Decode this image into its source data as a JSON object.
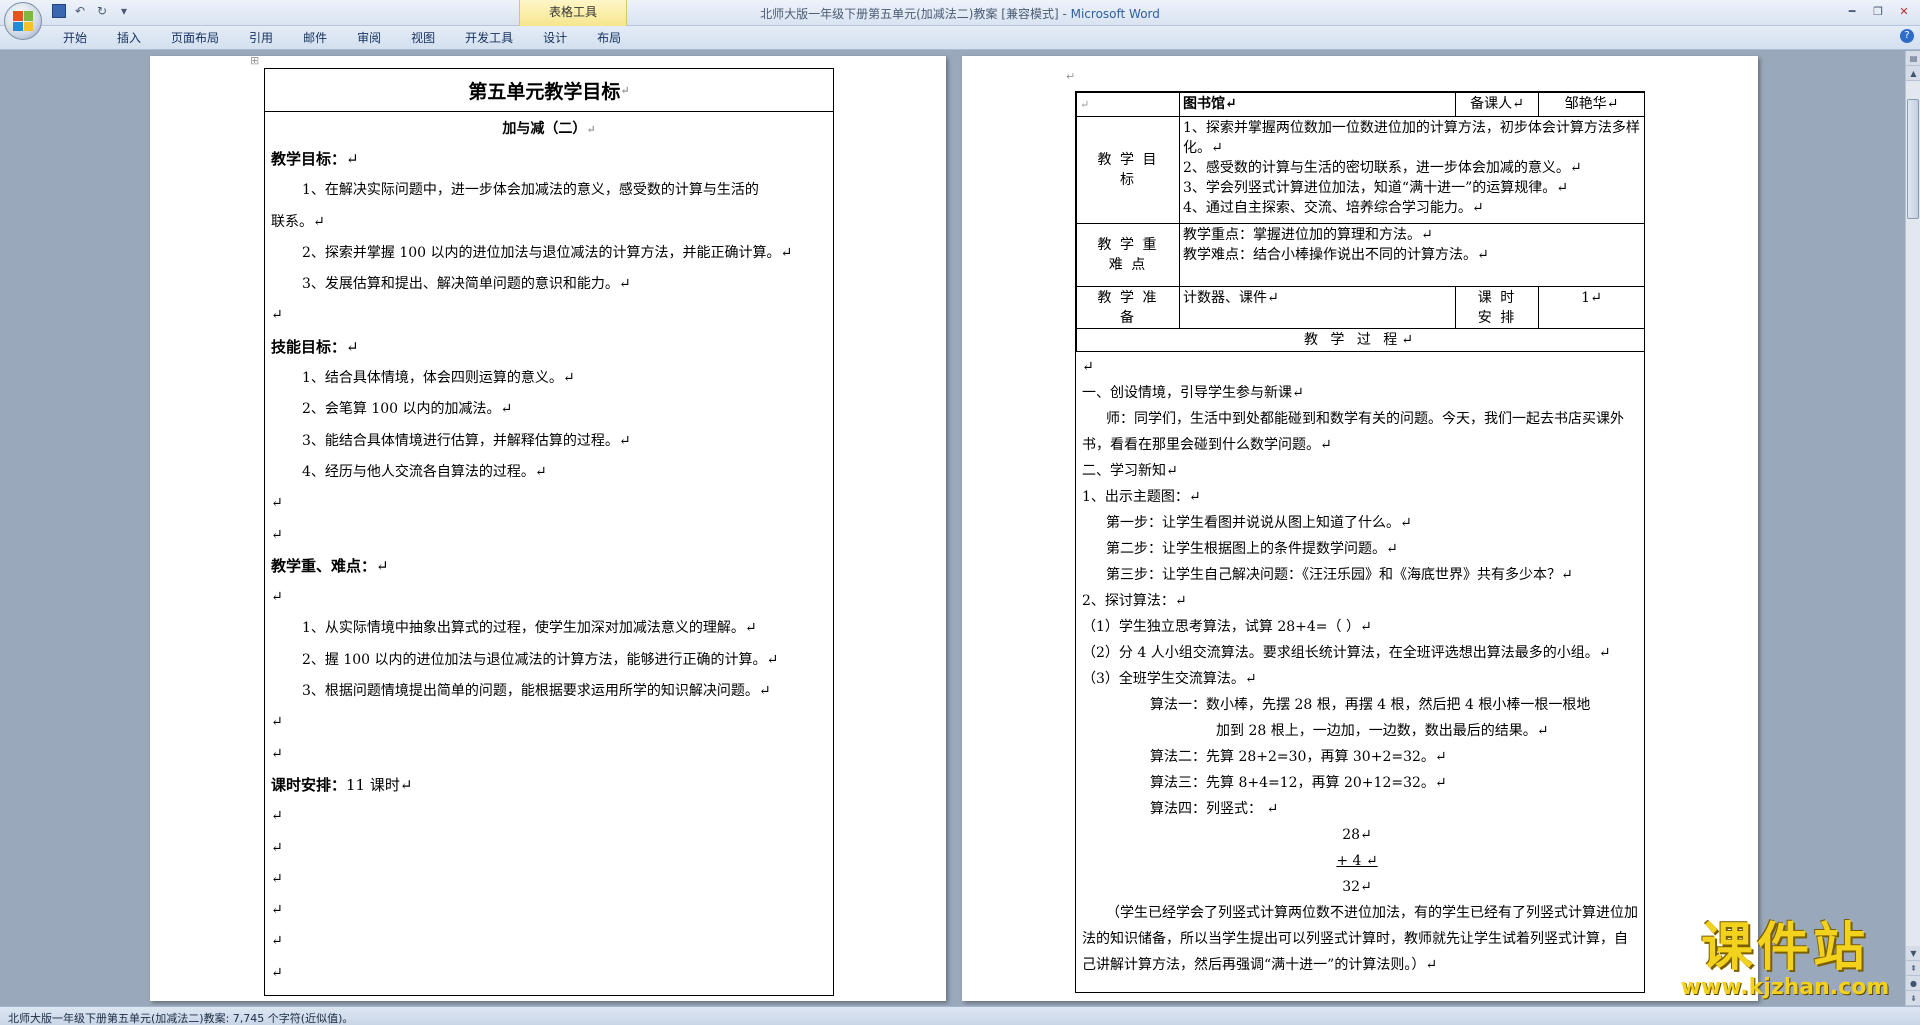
{
  "window": {
    "title": "北师大版一年级下册第五单元(加减法二)教案 [兼容模式] - ",
    "app_name": "Microsoft Word",
    "context_tab_group": "表格工具"
  },
  "ribbon": {
    "tabs": [
      "开始",
      "插入",
      "页面布局",
      "引用",
      "邮件",
      "审阅",
      "视图",
      "开发工具",
      "设计",
      "布局"
    ]
  },
  "left_page": {
    "title": "第五单元教学目标",
    "subtitle": "加与减（二）",
    "lines": [
      {
        "type": "head",
        "text": "教学目标：",
        "mark": "↵"
      },
      {
        "type": "ind",
        "text": "1、在解决实际问题中，进一步体会加减法的意义，感受数的计算与生活的"
      },
      {
        "type": "plain",
        "text": "联系。↵"
      },
      {
        "type": "ind",
        "text": "2、探索并掌握 100 以内的进位加法与退位减法的计算方法，并能正确计算。↵"
      },
      {
        "type": "ind",
        "text": "3、发展估算和提出、解决简单问题的意识和能力。↵"
      },
      {
        "type": "plain",
        "text": "↵"
      },
      {
        "type": "head",
        "text": "技能目标：",
        "mark": "↵"
      },
      {
        "type": "ind",
        "text": "1、结合具体情境，体会四则运算的意义。↵"
      },
      {
        "type": "ind",
        "text": "2、会笔算 100 以内的加减法。↵"
      },
      {
        "type": "ind",
        "text": "3、能结合具体情境进行估算，并解释估算的过程。↵"
      },
      {
        "type": "ind",
        "text": "4、经历与他人交流各自算法的过程。↵"
      },
      {
        "type": "plain",
        "text": "↵"
      },
      {
        "type": "plain",
        "text": "↵"
      },
      {
        "type": "head",
        "text": "教学重、难点：",
        "mark": "↵"
      },
      {
        "type": "plain",
        "text": "↵"
      },
      {
        "type": "ind",
        "text": "1、从实际情境中抽象出算式的过程，使学生加深对加减法意义的理解。↵"
      },
      {
        "type": "ind",
        "text": "2、握 100 以内的进位加法与退位减法的计算方法，能够进行正确的计算。↵"
      },
      {
        "type": "ind",
        "text": "3、根据问题情境提出简单的问题，能根据要求运用所学的知识解决问题。↵"
      },
      {
        "type": "plain",
        "text": "↵"
      },
      {
        "type": "plain",
        "text": "↵"
      },
      {
        "type": "head",
        "text": "课时安排：",
        "mark": "11 课时↵"
      },
      {
        "type": "plain",
        "text": "↵"
      },
      {
        "type": "plain",
        "text": "↵"
      },
      {
        "type": "plain",
        "text": "↵"
      },
      {
        "type": "plain",
        "text": "↵"
      },
      {
        "type": "plain",
        "text": "↵"
      },
      {
        "type": "plain",
        "text": "↵"
      }
    ]
  },
  "right_page": {
    "table": {
      "topic": "图书馆↵",
      "preparer_label": "备课人↵",
      "preparer_name": "邹艳华↵",
      "goals_label": "教 学 目 标",
      "goals": [
        "1、探索并掌握两位数加一位数进位加的计算方法，初步体会计算方法多样化。↵",
        "2、感受数的计算与生活的密切联系，进一步体会加减的意义。↵",
        "3、学会列竖式计算进位加法，知道“满十进一”的运算规律。↵",
        "4、通过自主探索、交流、培养综合学习能力。↵"
      ],
      "keypoints_label": "教 学 重 难 点",
      "keypoints": [
        " 教学重点：掌握进位加的算理和方法。↵",
        "教学难点：结合小棒操作说出不同的计算方法。↵"
      ],
      "prep_label": "教 学 准 备",
      "prep_value": "计数器、课件↵",
      "hours_label": "课 时 安 排",
      "hours_value": "1↵",
      "process_label": "教 学 过 程↵"
    },
    "lines": [
      {
        "cls": "",
        "text": "↵"
      },
      {
        "cls": "",
        "text": "一、创设情境，引导学生参与新课↵"
      },
      {
        "cls": "wrap i1",
        "text": "师：同学们，生活中到处都能碰到和数学有关的问题。今天，我们一起去书店买课外书，看看在那里会碰到什么数学问题。↵"
      },
      {
        "cls": "",
        "text": "二、学习新知↵"
      },
      {
        "cls": "",
        "text": "1、出示主题图：↵"
      },
      {
        "cls": "i1",
        "text": "第一步：让学生看图并说说从图上知道了什么。↵"
      },
      {
        "cls": "i1",
        "text": "第二步：让学生根据图上的条件提数学问题。↵"
      },
      {
        "cls": "i1",
        "text": "第三步：让学生自己解决问题：《汪汪乐园》和《海底世界》共有多少本？↵"
      },
      {
        "cls": "",
        "text": "2、探讨算法：↵"
      },
      {
        "cls": "",
        "text": "（1）学生独立思考算法，试算 28+4=（   ）↵"
      },
      {
        "cls": "wrap",
        "text": "（2）分 4 人小组交流算法。要求组长统计算法，在全班评选想出算法最多的小组。↵"
      },
      {
        "cls": "",
        "text": "（3）全班学生交流算法。↵"
      },
      {
        "cls": "i2",
        "text": "算法一：数小棒，先摆 28 根，再摆 4 根，然后把 4 根小棒一根一根地"
      },
      {
        "cls": "i3",
        "text": "加到 28 根上，一边加，一边数，数出最后的结果。↵"
      },
      {
        "cls": "i2",
        "text": "算法二：先算 28+2=30，再算 30+2=32。↵"
      },
      {
        "cls": "i2",
        "text": "算法三：先算 8+4=12，再算 20+12=32。↵"
      },
      {
        "cls": "i2",
        "text": "算法四：列竖式：      ↵"
      },
      {
        "cls": "c",
        "text": "28↵"
      },
      {
        "cls": "c under",
        "text": "+   4 ↵"
      },
      {
        "cls": "c",
        "text": "32↵"
      },
      {
        "cls": "wrap i1",
        "text": "（学生已经学会了列竖式计算两位数不进位加法，有的学生已经有了列竖式计算进位加法的知识储备，所以当学生提出可以列竖式计算时，教师就先让学生试着列竖式计算，自己讲解计算方法，然后再强调“满十进一”的计算法则。）↵"
      }
    ]
  },
  "status_bar": {
    "text": "北师大版一年级下册第五单元(加减法二)教案: 7,745 个字符(近似值)。"
  },
  "watermark": {
    "main": "课件站",
    "url": "www.kjzhan.com"
  }
}
